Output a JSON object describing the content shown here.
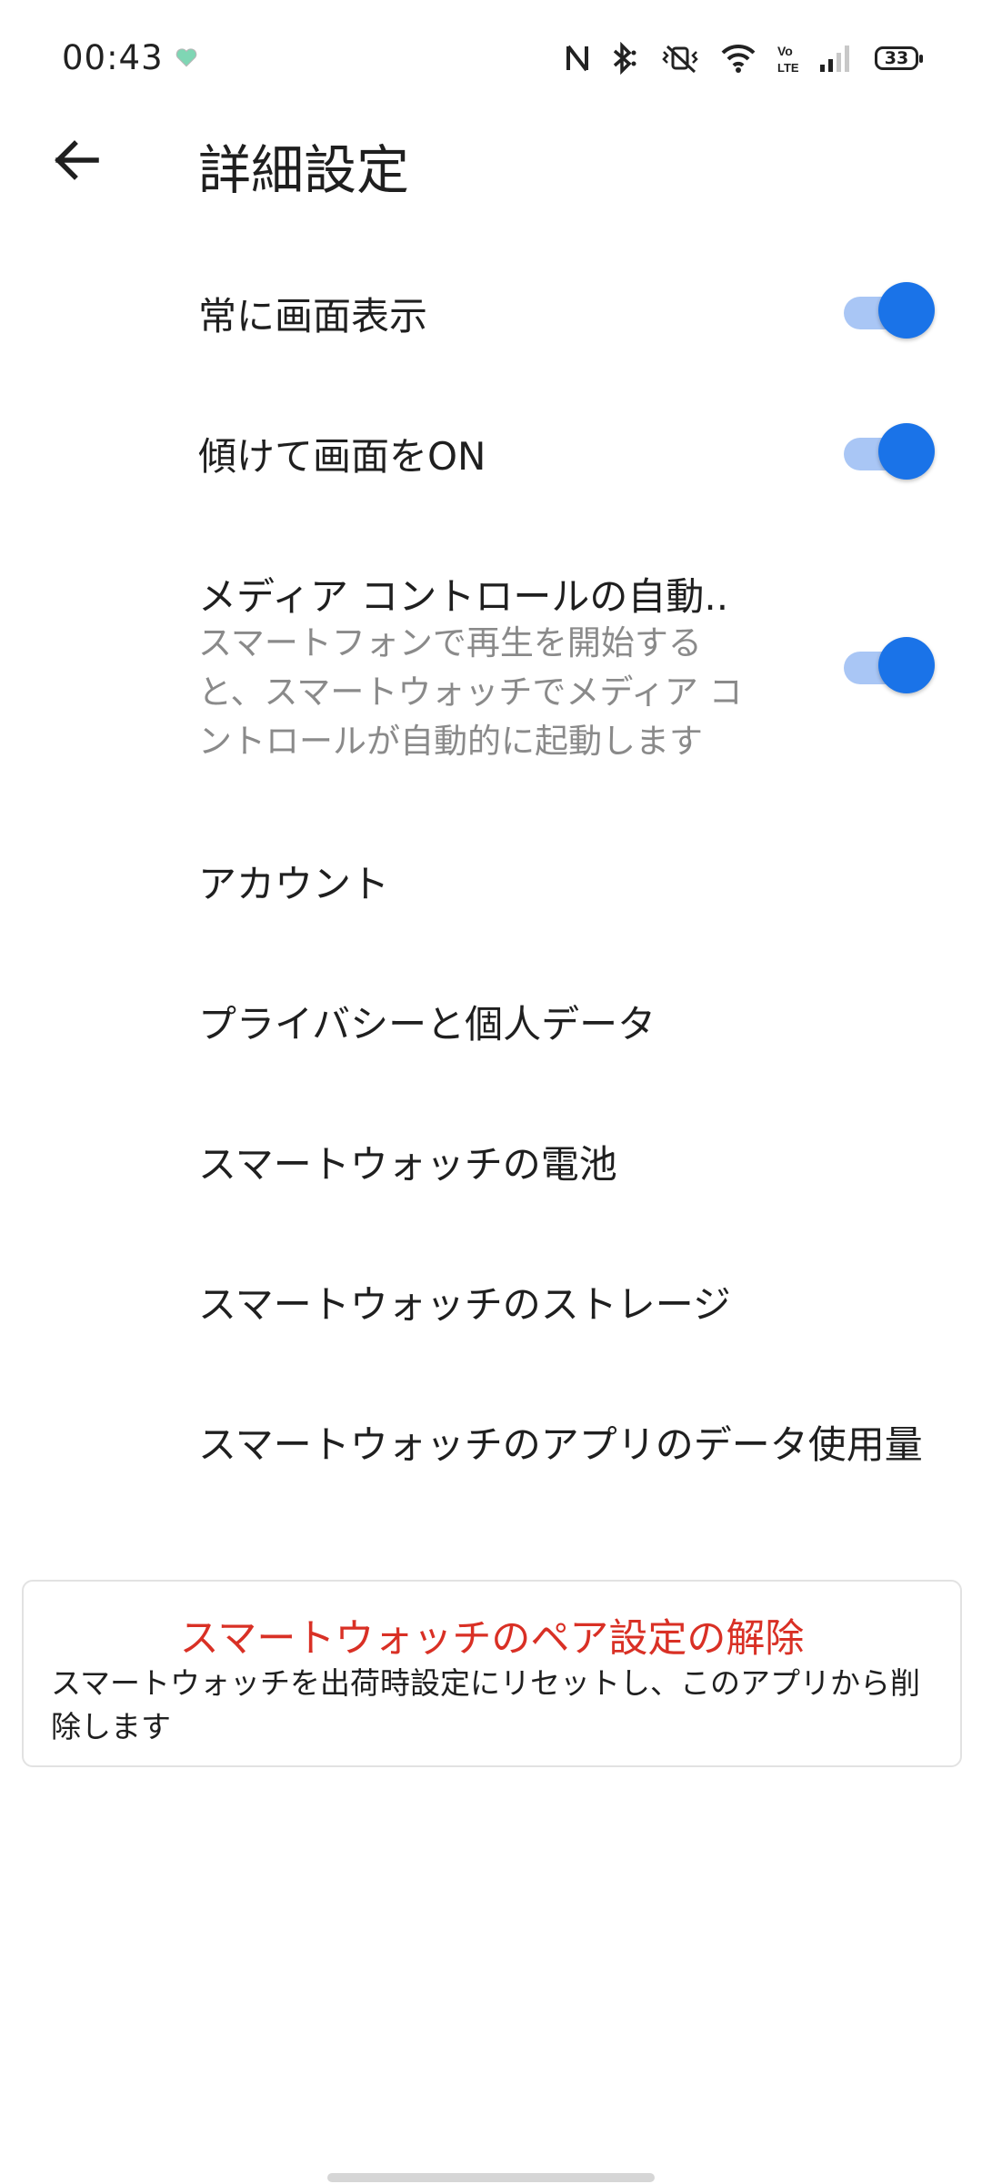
{
  "status_bar": {
    "time": "00:43",
    "battery": "33",
    "icons": [
      "heart-app-icon",
      "nfc-icon",
      "bluetooth-icon",
      "vibrate-mute-icon",
      "wifi-icon",
      "volte-icon",
      "signal-icon",
      "battery-icon"
    ]
  },
  "header": {
    "back_icon": "arrow-left-icon",
    "title": "詳細設定"
  },
  "settings": [
    {
      "label": "常に画面表示",
      "toggle": true
    },
    {
      "label": "傾けて画面をON",
      "toggle": true
    },
    {
      "label": "メディア コントロールの自動..",
      "description": "スマートフォンで再生を開始すると、スマートウォッチでメディア コントロールが自動的に起動します",
      "toggle": true
    },
    {
      "label": "アカウント"
    },
    {
      "label": "プライバシーと個人データ"
    },
    {
      "label": "スマートウォッチの電池"
    },
    {
      "label": "スマートウォッチのストレージ"
    },
    {
      "label": "スマートウォッチのアプリのデータ使用量"
    }
  ],
  "unpair": {
    "title": "スマートウォッチのペア設定の解除",
    "description": "スマートウォッチを出荷時設定にリセットし、このアプリから削除します"
  },
  "colors": {
    "accent": "#1a73e8",
    "toggle_track": "#a9c6f5",
    "danger": "#d93025",
    "secondary_text": "#8a8a8a"
  }
}
